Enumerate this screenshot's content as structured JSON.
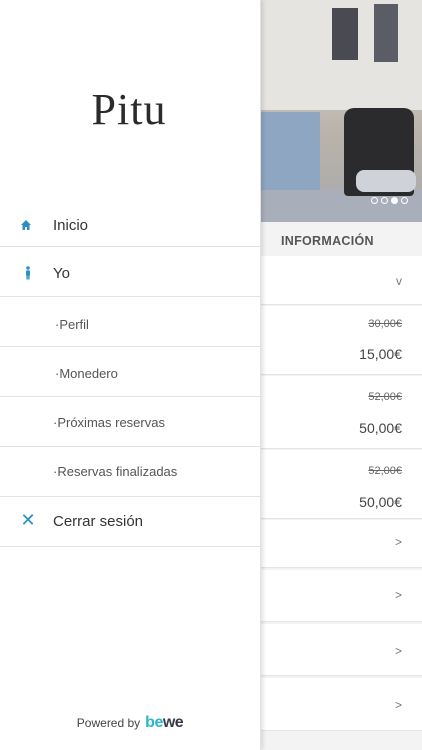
{
  "drawer": {
    "logo": "Pitu",
    "menu": [
      {
        "label": "Inicio",
        "icon": "home-icon"
      },
      {
        "label": "Yo",
        "icon": "person-icon"
      },
      {
        "label": "·Perfil"
      },
      {
        "label": "·Monedero"
      },
      {
        "label": "·Próximas reservas"
      },
      {
        "label": "·Reservas finalizadas"
      },
      {
        "label": "Cerrar sesión",
        "icon": "close-icon"
      }
    ],
    "footer": {
      "powered_by": "Powered by",
      "brand_a": "be",
      "brand_b": "we"
    }
  },
  "background": {
    "carousel": {
      "count": 4,
      "active": 2
    },
    "section_title": "INFORMACIÓN",
    "expand_chevron": "v",
    "prices": [
      {
        "old": "30,00€",
        "new": "15,00€"
      },
      {
        "old": "52,00€",
        "new": "50,00€"
      },
      {
        "old": "52,00€",
        "new": "50,00€"
      }
    ],
    "row_chevron": ">"
  },
  "colors": {
    "accent": "#2b8fc2",
    "brand": "#2bb7c7"
  }
}
